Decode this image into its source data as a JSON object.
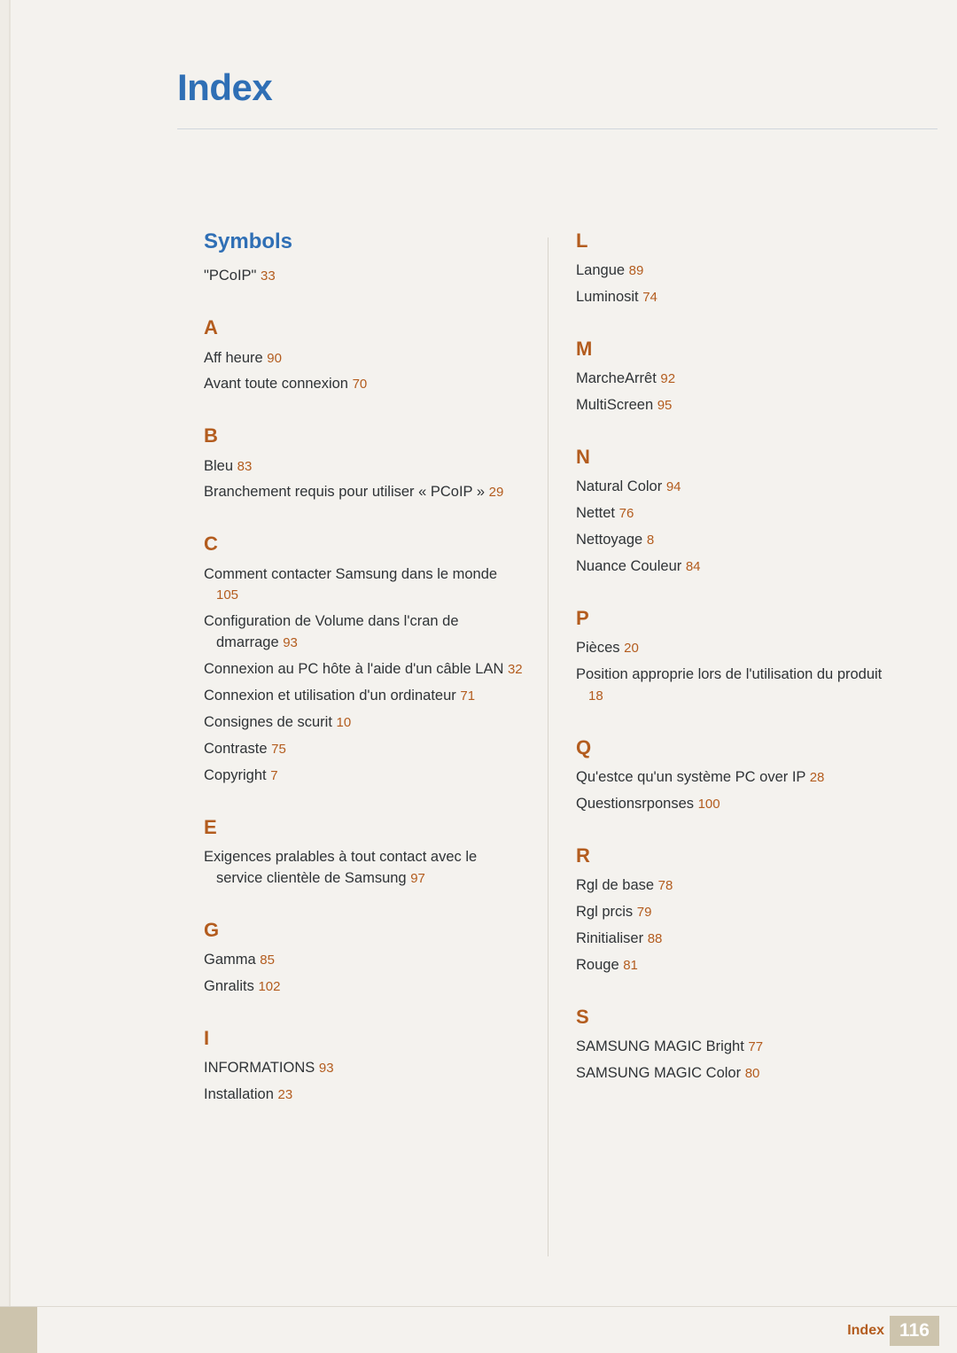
{
  "header": {
    "title": "Index"
  },
  "sections": {
    "left": [
      {
        "type": "section",
        "label": "Symbols",
        "entries": [
          {
            "text": "\"PCoIP\"",
            "page": "33"
          }
        ]
      },
      {
        "type": "letter",
        "label": "A",
        "entries": [
          {
            "text": "Aff heure",
            "page": "90"
          },
          {
            "text": "Avant toute connexion",
            "page": "70"
          }
        ]
      },
      {
        "type": "letter",
        "label": "B",
        "entries": [
          {
            "text": "Bleu",
            "page": "83"
          },
          {
            "text": "Branchement requis pour utiliser « PCoIP »",
            "page": "29"
          }
        ]
      },
      {
        "type": "letter",
        "label": "C",
        "entries": [
          {
            "text": "Comment contacter Samsung dans le monde",
            "page": "105"
          },
          {
            "text": "Configuration de Volume dans l'cran de dmarrage",
            "page": "93"
          },
          {
            "text": "Connexion au PC hôte à l'aide d'un câble LAN",
            "page": "32"
          },
          {
            "text": "Connexion et utilisation d'un ordinateur",
            "page": "71"
          },
          {
            "text": "Consignes de scurit",
            "page": "10"
          },
          {
            "text": "Contraste",
            "page": "75"
          },
          {
            "text": "Copyright",
            "page": "7"
          }
        ]
      },
      {
        "type": "letter",
        "label": "E",
        "entries": [
          {
            "text": "Exigences pralables à tout contact avec le service clientèle de Samsung",
            "page": "97"
          }
        ]
      },
      {
        "type": "letter",
        "label": "G",
        "entries": [
          {
            "text": "Gamma",
            "page": "85"
          },
          {
            "text": "Gnralits",
            "page": "102"
          }
        ]
      },
      {
        "type": "letter",
        "label": "I",
        "entries": [
          {
            "text": "INFORMATIONS",
            "page": "93"
          },
          {
            "text": "Installation",
            "page": "23"
          }
        ]
      }
    ],
    "right": [
      {
        "type": "letter",
        "label": "L",
        "entries": [
          {
            "text": "Langue",
            "page": "89"
          },
          {
            "text": "Luminosit",
            "page": "74"
          }
        ]
      },
      {
        "type": "letter",
        "label": "M",
        "entries": [
          {
            "text": "MarcheArrêt",
            "page": "92"
          },
          {
            "text": "MultiScreen",
            "page": "95"
          }
        ]
      },
      {
        "type": "letter",
        "label": "N",
        "entries": [
          {
            "text": "Natural Color",
            "page": "94"
          },
          {
            "text": "Nettet",
            "page": "76"
          },
          {
            "text": "Nettoyage",
            "page": "8"
          },
          {
            "text": "Nuance Couleur",
            "page": "84"
          }
        ]
      },
      {
        "type": "letter",
        "label": "P",
        "entries": [
          {
            "text": "Pièces",
            "page": "20"
          },
          {
            "text": "Position approprie lors de l'utilisation du produit",
            "page": "18"
          }
        ]
      },
      {
        "type": "letter",
        "label": "Q",
        "entries": [
          {
            "text": "Qu'estce qu'un système PC over IP",
            "page": "28"
          },
          {
            "text": "Questionsrponses",
            "page": "100"
          }
        ]
      },
      {
        "type": "letter",
        "label": "R",
        "entries": [
          {
            "text": "Rgl de base",
            "page": "78"
          },
          {
            "text": "Rgl prcis",
            "page": "79"
          },
          {
            "text": "Rinitialiser",
            "page": "88"
          },
          {
            "text": "Rouge",
            "page": "81"
          }
        ]
      },
      {
        "type": "letter",
        "label": "S",
        "entries": [
          {
            "text": "SAMSUNG MAGIC Bright",
            "page": "77"
          },
          {
            "text": "SAMSUNG MAGIC Color",
            "page": "80"
          }
        ]
      }
    ]
  },
  "footer": {
    "label": "Index",
    "page_number": "116"
  },
  "colors": {
    "heading_blue": "#2f6fb5",
    "letter_orange": "#b35c1e",
    "page_number_orange": "#b35c1e",
    "body_text": "#2f3336",
    "background": "#f4f2ee",
    "footer_tan": "#cdc4ad"
  }
}
